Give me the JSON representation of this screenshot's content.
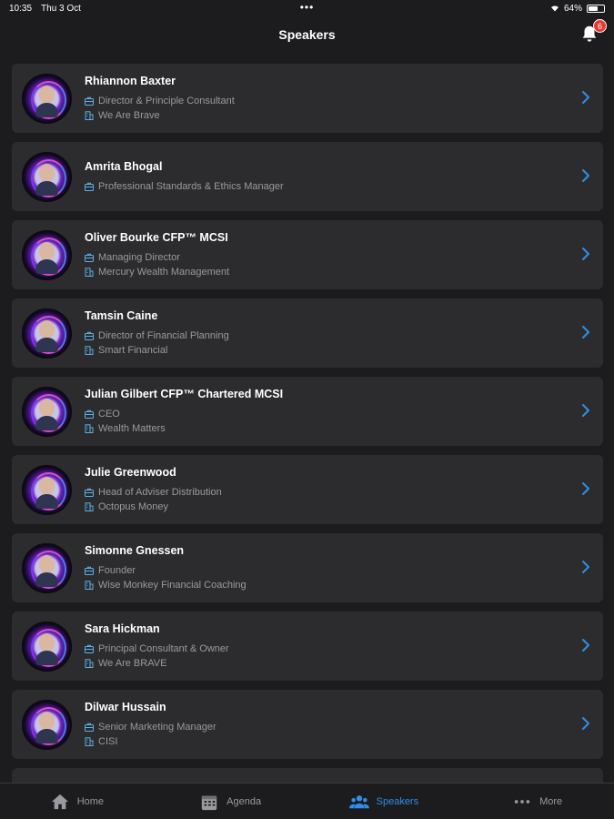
{
  "status": {
    "time": "10:35",
    "date": "Thu 3 Oct",
    "dots": "•••",
    "battery": "64%"
  },
  "header": {
    "title": "Speakers",
    "notifications": "6"
  },
  "speakers": [
    {
      "name": "Rhiannon Baxter",
      "role": "Director & Principle Consultant",
      "company": "We Are Brave"
    },
    {
      "name": "Amrita Bhogal",
      "role": "Professional Standards & Ethics Manager",
      "company": ""
    },
    {
      "name": "Oliver Bourke CFP™ MCSI",
      "role": "Managing Director",
      "company": "Mercury Wealth Management"
    },
    {
      "name": "Tamsin Caine",
      "role": "Director of Financial Planning",
      "company": "Smart Financial"
    },
    {
      "name": "Julian Gilbert CFP™ Chartered MCSI",
      "role": "CEO",
      "company": "Wealth Matters"
    },
    {
      "name": "Julie Greenwood",
      "role": "Head of Adviser Distribution",
      "company": "Octopus Money"
    },
    {
      "name": "Simonne Gnessen",
      "role": "Founder",
      "company": "Wise Monkey Financial Coaching"
    },
    {
      "name": "Sara Hickman",
      "role": "Principal Consultant & Owner",
      "company": "We Are BRAVE"
    },
    {
      "name": "Dilwar Hussain",
      "role": "Senior Marketing Manager",
      "company": "CISI"
    }
  ],
  "tabs": [
    {
      "label": "Home",
      "icon": "home-icon"
    },
    {
      "label": "Agenda",
      "icon": "calendar-icon"
    },
    {
      "label": "Speakers",
      "icon": "people-icon"
    },
    {
      "label": "More",
      "icon": "more-icon"
    }
  ],
  "colors": {
    "accent": "#2f8fe8",
    "card": "#2c2c2e",
    "badge": "#e53935"
  }
}
